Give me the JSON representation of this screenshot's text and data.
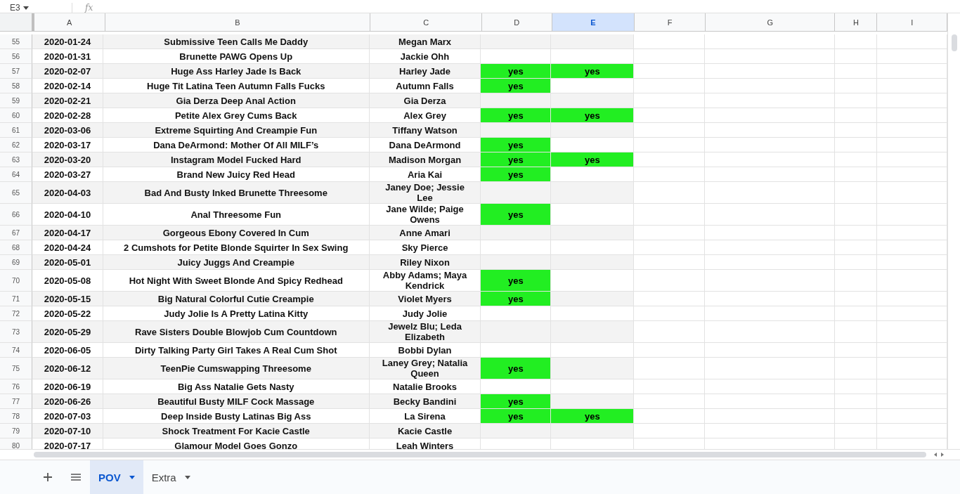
{
  "formula_bar": {
    "cell_ref": "E3",
    "fx": "fx"
  },
  "columns": [
    {
      "label": "A",
      "selected": false
    },
    {
      "label": "B",
      "selected": false
    },
    {
      "label": "C",
      "selected": false
    },
    {
      "label": "D",
      "selected": false
    },
    {
      "label": "E",
      "selected": true
    },
    {
      "label": "F",
      "selected": false
    },
    {
      "label": "G",
      "selected": false
    },
    {
      "label": "H",
      "selected": false
    },
    {
      "label": "I",
      "selected": false
    }
  ],
  "rows": [
    {
      "num": "55",
      "date": "2020-01-24",
      "title": "Submissive Teen Calls Me Daddy",
      "performers": "Megan Marx"
    },
    {
      "num": "56",
      "date": "2020-01-31",
      "title": "Brunette PAWG Opens Up",
      "performers": "Jackie Ohh"
    },
    {
      "num": "57",
      "date": "2020-02-07",
      "title": "Huge Ass Harley Jade Is Back",
      "performers": "Harley Jade",
      "d": "yes",
      "e": "yes"
    },
    {
      "num": "58",
      "date": "2020-02-14",
      "title": "Huge Tit Latina Teen Autumn Falls Fucks",
      "performers": "Autumn Falls",
      "d": "yes"
    },
    {
      "num": "59",
      "date": "2020-02-21",
      "title": "Gia Derza Deep Anal Action",
      "performers": "Gia Derza"
    },
    {
      "num": "60",
      "date": "2020-02-28",
      "title": "Petite Alex Grey Cums Back",
      "performers": "Alex Grey",
      "d": "yes",
      "e": "yes"
    },
    {
      "num": "61",
      "date": "2020-03-06",
      "title": "Extreme Squirting And Creampie Fun",
      "performers": "Tiffany Watson"
    },
    {
      "num": "62",
      "date": "2020-03-17",
      "title": "Dana DeArmond: Mother Of All MILF’s",
      "performers": "Dana DeArmond",
      "d": "yes"
    },
    {
      "num": "63",
      "date": "2020-03-20",
      "title": "Instagram Model Fucked Hard",
      "performers": "Madison Morgan",
      "d": "yes",
      "e": "yes"
    },
    {
      "num": "64",
      "date": "2020-03-27",
      "title": "Brand New Juicy Red Head",
      "performers": "Aria Kai",
      "d": "yes"
    },
    {
      "num": "65",
      "date": "2020-04-03",
      "title": "Bad And Busty Inked Brunette Threesome",
      "performers": "Janey Doe; Jessie Lee"
    },
    {
      "num": "66",
      "date": "2020-04-10",
      "title": "Anal Threesome Fun",
      "performers": "Jane Wilde; Paige Owens",
      "d": "yes"
    },
    {
      "num": "67",
      "date": "2020-04-17",
      "title": "Gorgeous Ebony Covered In Cum",
      "performers": "Anne Amari"
    },
    {
      "num": "68",
      "date": "2020-04-24",
      "title": "2 Cumshots for Petite Blonde Squirter In Sex Swing",
      "performers": "Sky Pierce"
    },
    {
      "num": "69",
      "date": "2020-05-01",
      "title": "Juicy Juggs And Creampie",
      "performers": "Riley Nixon"
    },
    {
      "num": "70",
      "date": "2020-05-08",
      "title": "Hot Night With Sweet Blonde And Spicy Redhead",
      "performers": "Abby Adams; Maya Kendrick",
      "d": "yes"
    },
    {
      "num": "71",
      "date": "2020-05-15",
      "title": "Big Natural Colorful Cutie Creampie",
      "performers": "Violet Myers",
      "d": "yes"
    },
    {
      "num": "72",
      "date": "2020-05-22",
      "title": "Judy Jolie Is A Pretty Latina Kitty",
      "performers": "Judy Jolie"
    },
    {
      "num": "73",
      "date": "2020-05-29",
      "title": "Rave Sisters Double Blowjob Cum Countdown",
      "performers": "Jewelz Blu; Leda Elizabeth"
    },
    {
      "num": "74",
      "date": "2020-06-05",
      "title": "Dirty Talking Party Girl Takes A Real Cum Shot",
      "performers": "Bobbi Dylan"
    },
    {
      "num": "75",
      "date": "2020-06-12",
      "title": "TeenPie Cumswapping Threesome",
      "performers": "Laney Grey; Natalia Queen",
      "d": "yes"
    },
    {
      "num": "76",
      "date": "2020-06-19",
      "title": "Big Ass Natalie Gets Nasty",
      "performers": "Natalie Brooks"
    },
    {
      "num": "77",
      "date": "2020-06-26",
      "title": "Beautiful Busty MILF Cock Massage",
      "performers": "Becky Bandini",
      "d": "yes"
    },
    {
      "num": "78",
      "date": "2020-07-03",
      "title": "Deep Inside Busty Latinas Big Ass",
      "performers": "La Sirena",
      "d": "yes",
      "e": "yes"
    },
    {
      "num": "79",
      "date": "2020-07-10",
      "title": "Shock Treatment For Kacie Castle",
      "performers": "Kacie Castle"
    },
    {
      "num": "80",
      "date": "2020-07-17",
      "title": "Glamour Model Goes Gonzo",
      "performers": "Leah Winters"
    }
  ],
  "sheet_tabs": [
    {
      "label": "POV",
      "selected": true
    },
    {
      "label": "Extra",
      "selected": false
    }
  ]
}
